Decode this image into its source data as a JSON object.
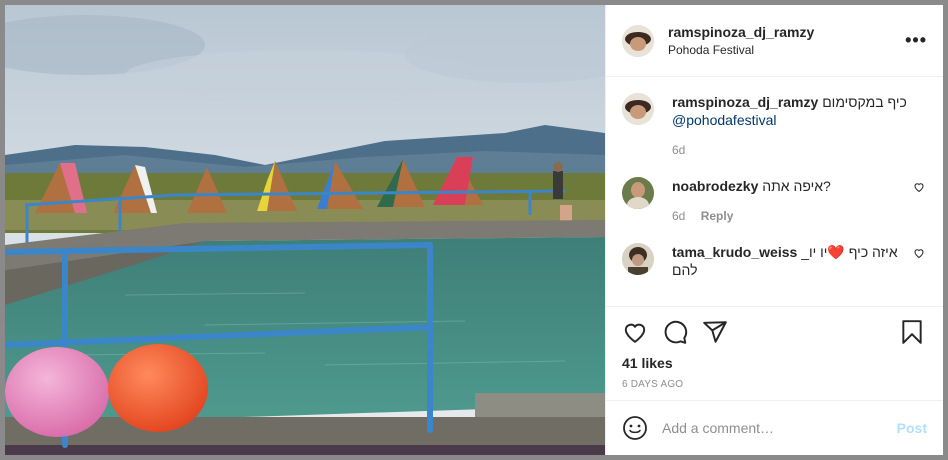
{
  "post": {
    "author": "ramspinoza_dj_ramzy",
    "location": "Pohoda Festival",
    "more_glyph": "•••",
    "caption": {
      "username": "ramspinoza_dj_ramzy",
      "text": "כיף במקסימום",
      "mention": "@pohodafestival",
      "time": "6d"
    },
    "comments": [
      {
        "username": "noabrodezky",
        "text": "איפה אתה?",
        "time": "6d",
        "reply_label": "Reply"
      },
      {
        "username": "tama_krudo_weiss",
        "text": "_איזה כיף ❤️יו יו",
        "text2": "להם"
      }
    ],
    "likes": "41 likes",
    "ago": "6 DAYS AGO",
    "comment_box": {
      "placeholder": "Add a comment…",
      "post_label": "Post"
    }
  },
  "colors": {
    "link": "#00376b",
    "post_button": "#b2dffc",
    "muted": "#8e8e8e",
    "pool_water": "#3f8a80",
    "railing": "#3a86c8"
  }
}
